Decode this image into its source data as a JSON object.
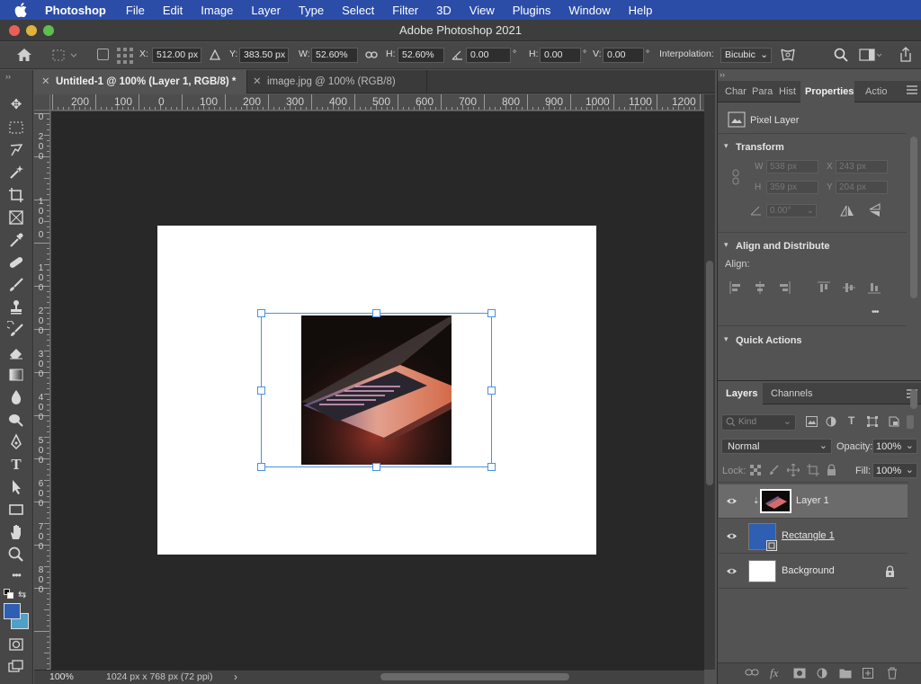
{
  "menubar": {
    "apple_icon": "apple-icon",
    "app_name": "Photoshop",
    "items": [
      "File",
      "Edit",
      "Image",
      "Layer",
      "Type",
      "Select",
      "Filter",
      "3D",
      "View",
      "Plugins",
      "Window",
      "Help"
    ]
  },
  "window": {
    "title": "Adobe Photoshop 2021"
  },
  "options": {
    "x_label": "X:",
    "x_value": "512.00 px",
    "y_label": "Y:",
    "y_value": "383.50 px",
    "w_label": "W:",
    "w_value": "52.60%",
    "h_label": "H:",
    "h_value": "52.60%",
    "angle_value": "0.00",
    "deg": "°",
    "hskew_label": "H:",
    "hskew_value": "0.00",
    "vskew_label": "V:",
    "vskew_value": "0.00",
    "interp_label": "Interpolation:",
    "interp_value": "Bicubic"
  },
  "tabs": [
    {
      "label": "Untitled-1 @ 100% (Layer 1, RGB/8) *",
      "active": true
    },
    {
      "label": "image.jpg @ 100% (RGB/8)",
      "active": false
    }
  ],
  "ruler": {
    "h_ticks": [
      "200",
      "100",
      "0",
      "100",
      "200",
      "300",
      "400",
      "500",
      "600",
      "700",
      "800",
      "900",
      "1000",
      "1100",
      "1200"
    ],
    "v_ticks": [
      "0",
      "2\n0\n0",
      "1\n0\n0",
      "0",
      "1\n0\n0",
      "2\n0\n0",
      "3\n0\n0",
      "4\n0\n0",
      "5\n0\n0",
      "6\n0\n0",
      "7\n0\n0",
      "8\n0\n0"
    ]
  },
  "status": {
    "zoom": "100%",
    "doc_info": "1024 px x 768 px (72 ppi)",
    "arrow": "›"
  },
  "panels": {
    "top_tabs": [
      "Char",
      "Para",
      "Hist",
      "Properties",
      "Actio"
    ],
    "properties": {
      "kind": "Pixel Layer",
      "transform_title": "Transform",
      "w_label": "W",
      "w_value": "538 px",
      "x_label": "X",
      "x_value": "243 px",
      "h_label": "H",
      "h_value": "359 px",
      "y_label": "Y",
      "y_value": "204 px",
      "angle_value": "0.00°",
      "align_title": "Align and Distribute",
      "align_label": "Align:",
      "more": "•••",
      "quick_title": "Quick Actions"
    },
    "layers_tabs": [
      "Layers",
      "Channels"
    ],
    "kind_placeholder": "Kind",
    "blend_mode": "Normal",
    "opacity_label": "Opacity:",
    "opacity_value": "100%",
    "lock_label": "Lock:",
    "fill_label": "Fill:",
    "fill_value": "100%",
    "layers": [
      {
        "name": "Layer 1",
        "selected": true
      },
      {
        "name": "Rectangle 1",
        "selected": false
      },
      {
        "name": "Background",
        "selected": false,
        "locked": true
      }
    ]
  },
  "colors": {
    "menubar": "#2b4da8",
    "selection": "#4a90e2",
    "foreground": "#2f5fb3",
    "background": "#4fa0c8"
  }
}
